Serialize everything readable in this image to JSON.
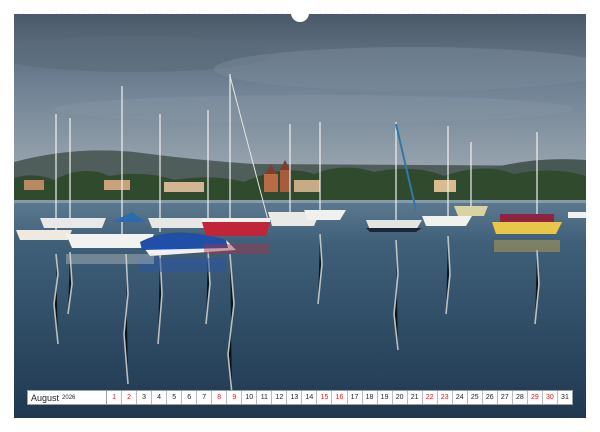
{
  "calendar": {
    "month": "August",
    "year": "2026",
    "days": [
      "1",
      "2",
      "3",
      "4",
      "5",
      "6",
      "7",
      "8",
      "9",
      "10",
      "11",
      "12",
      "13",
      "14",
      "15",
      "16",
      "17",
      "18",
      "19",
      "20",
      "21",
      "22",
      "23",
      "24",
      "25",
      "26",
      "27",
      "28",
      "29",
      "30",
      "31"
    ],
    "weekend_days": [
      1,
      2,
      8,
      9,
      15,
      16,
      22,
      23,
      29,
      30
    ]
  },
  "colors": {
    "weekend": "#cc1f1f",
    "text": "#222222",
    "water": "#2e4a63",
    "sky": "#6f8193"
  }
}
